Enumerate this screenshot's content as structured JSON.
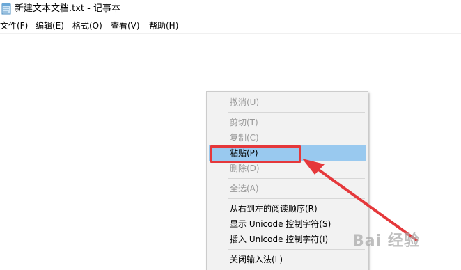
{
  "window": {
    "title": "新建文本文档.txt - 记事本"
  },
  "menubar": [
    {
      "label": "文件(F)"
    },
    {
      "label": "编辑(E)"
    },
    {
      "label": "格式(O)"
    },
    {
      "label": "查看(V)"
    },
    {
      "label": "帮助(H)"
    }
  ],
  "context_menu": {
    "items": [
      {
        "label": "撤消(U)",
        "enabled": false
      },
      {
        "label": "剪切(T)",
        "enabled": false
      },
      {
        "label": "复制(C)",
        "enabled": false
      },
      {
        "label": "粘贴(P)",
        "enabled": true,
        "highlighted": true
      },
      {
        "label": "删除(D)",
        "enabled": false
      },
      {
        "label": "全选(A)",
        "enabled": false
      },
      {
        "label": "从右到左的阅读顺序(R)",
        "enabled": true
      },
      {
        "label": "显示 Unicode 控制字符(S)",
        "enabled": true
      },
      {
        "label": "插入 Unicode 控制字符(I)",
        "enabled": true
      },
      {
        "label": "关闭输入法(L)",
        "enabled": true
      }
    ]
  },
  "annotation": {
    "color": "#e5383b"
  },
  "watermark": {
    "text": "Bai 经验"
  },
  "colors": {
    "highlight": "#99c9ef",
    "disabled_text": "#9a9a9a",
    "menu_bg": "#f2f2f2"
  },
  "icons": {
    "app": "notepad-icon"
  }
}
